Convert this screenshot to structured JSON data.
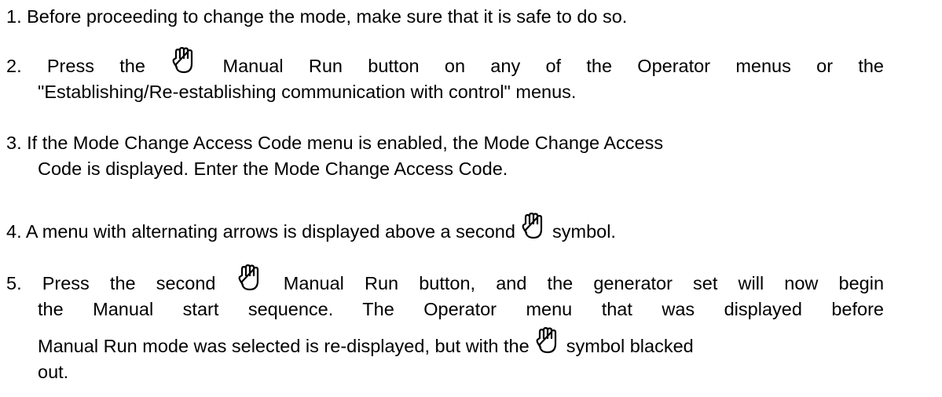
{
  "steps": [
    {
      "lines": [
        "1. Before proceeding to change the mode, make sure that it is safe to do so."
      ]
    },
    {
      "line1_a": "2.  Press the",
      "line1_b": "Manual Run button on any of the Operator menus or the",
      "line2": "\"Establishing/Re-establishing communication with control\" menus."
    },
    {
      "line1": "3. If the Mode Change Access Code menu is enabled, the Mode Change Access",
      "line2": "Code is displayed. Enter the Mode Change Access Code."
    },
    {
      "line1_a": "4. A menu with alternating arrows is displayed above a second",
      "line1_b": "symbol."
    },
    {
      "line1_a": "5.  Press the second",
      "line1_b": "Manual Run button, and the generator set will now begin",
      "line2": "the Manual start sequence. The Operator menu that was displayed before",
      "line3_a": "Manual Run mode was selected is re-displayed, but with the",
      "line3_b": "symbol blacked",
      "line4": "out."
    }
  ],
  "icons": {
    "manual_run": "hand-icon"
  }
}
